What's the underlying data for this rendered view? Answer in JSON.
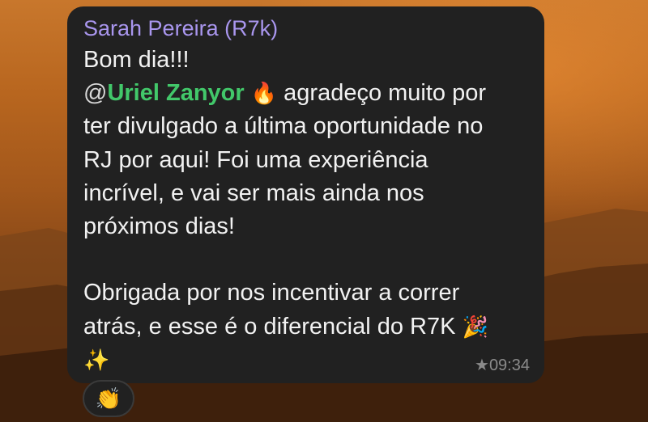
{
  "message": {
    "sender": "Sarah Pereira (R7k)",
    "greeting": "Bom dia!!!",
    "mention_at": "@",
    "mention_name": "Uriel Zanyor",
    "mention_emoji": "🔥",
    "line2_rest": " agradeço muito por",
    "line3": "ter divulgado a última oportunidade no",
    "line4": "RJ por aqui! Foi uma experiência",
    "line5": "incrível, e vai ser mais ainda nos",
    "line6": "próximos dias!",
    "line7": "Obrigada por nos incentivar a correr",
    "line8": "atrás, e esse é o diferencial do R7K ",
    "party_emoji": "🎉",
    "sparkles_emoji": "✨",
    "star_icon": "★",
    "time": "09:34"
  },
  "reaction": {
    "emoji": "👏"
  },
  "colors": {
    "bubble": "#212121",
    "sender": "#a996ee",
    "mention": "#42c86a",
    "text": "#f2f2f2",
    "meta": "#8a8a8a"
  }
}
